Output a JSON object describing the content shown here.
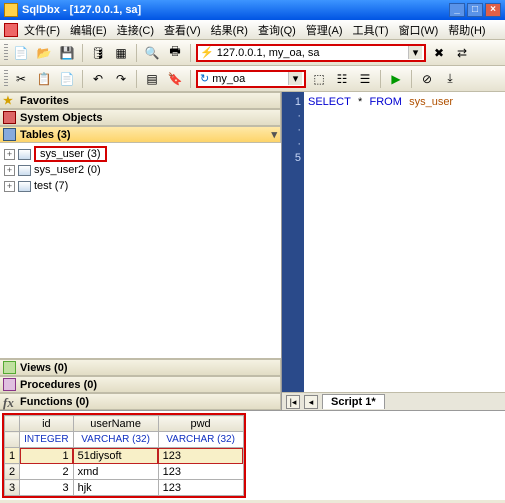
{
  "title": "SqlDbx - [127.0.0.1, sa]",
  "menu": [
    "文件(F)",
    "编辑(E)",
    "连接(C)",
    "查看(V)",
    "结果(R)",
    "查询(Q)",
    "管理(A)",
    "工具(T)",
    "窗口(W)",
    "帮助(H)"
  ],
  "conn_combo": "127.0.0.1, my_oa, sa",
  "db_combo": "my_oa",
  "sections": {
    "favorites": "Favorites",
    "sysobj": "System Objects",
    "tables": "Tables (3)",
    "views": "Views (0)",
    "procs": "Procedures (0)",
    "funcs": "Functions (0)"
  },
  "tree": [
    {
      "label": "sys_user (3)",
      "hl": true
    },
    {
      "label": "sys_user2 (0)",
      "hl": false
    },
    {
      "label": "test (7)",
      "hl": false
    }
  ],
  "gutter": [
    "1",
    "·",
    "·",
    "·",
    "5"
  ],
  "sql": {
    "kw1": "SELECT",
    "star": "*",
    "kw2": "FROM",
    "tbl": "sys_user"
  },
  "script_tab": "Script 1*",
  "grid": {
    "cols": [
      "id",
      "userName",
      "pwd"
    ],
    "types": [
      "INTEGER",
      "VARCHAR (32)",
      "VARCHAR (32)"
    ],
    "rows": [
      {
        "n": "1",
        "id": "1",
        "user": "51diysoft",
        "pwd": "123",
        "hl": true
      },
      {
        "n": "2",
        "id": "2",
        "user": "xmd",
        "pwd": "123",
        "hl": false
      },
      {
        "n": "3",
        "id": "3",
        "user": "hjk",
        "pwd": "123",
        "hl": false
      }
    ]
  },
  "wbtn": {
    "min": "_",
    "max": "□",
    "close": "×"
  }
}
